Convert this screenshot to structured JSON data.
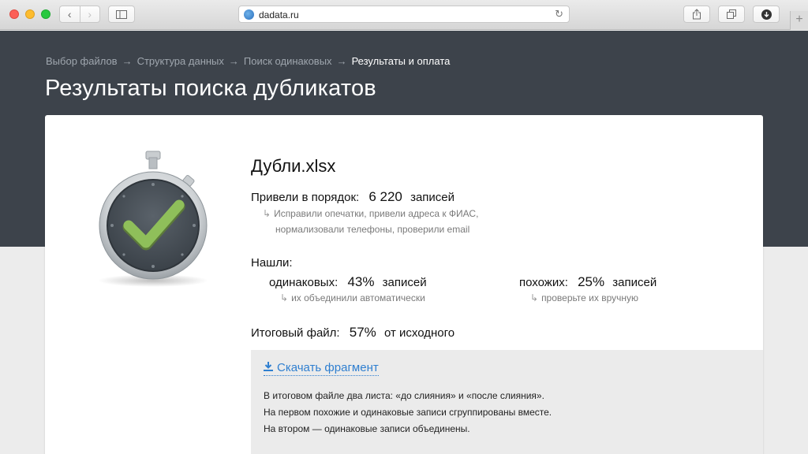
{
  "browser": {
    "url": "dadata.ru",
    "back_glyph": "‹",
    "forward_glyph": "›",
    "reload_glyph": "↻",
    "newtab_glyph": "+",
    "sidebar_icon": "sidebar-icon",
    "share_icon": "share-icon",
    "tabs_icon": "tabs-icon",
    "download_icon": "download-icon"
  },
  "breadcrumb": {
    "items": [
      "Выбор файлов",
      "Структура данных",
      "Поиск одинаковых",
      "Результаты и оплата"
    ],
    "separator": "→"
  },
  "page": {
    "title": "Результаты поиска дубликатов"
  },
  "result": {
    "file_name": "Дубли.xlsx",
    "cleaned": {
      "label": "Привели в порядок:",
      "value": "6 220",
      "unit": "записей",
      "note_line1": "Исправили опечатки, привели адреса к ФИАС,",
      "note_line2": "нормализовали телефоны, проверили email"
    },
    "found_label": "Нашли:",
    "identical": {
      "label": "одинаковых:",
      "value": "43%",
      "unit": "записей",
      "note": "их объединили автоматически"
    },
    "similar": {
      "label": "похожих:",
      "value": "25%",
      "unit": "записей",
      "note": "проверьте их вручную"
    },
    "total": {
      "label": "Итоговый файл:",
      "value": "57%",
      "unit": "от исходного"
    }
  },
  "download": {
    "link_label": "Скачать фрагмент",
    "line1": "В итоговом файле два листа: «до слияния» и «после слияния».",
    "line2": "На первом похожие и одинаковые записи сгруппированы вместе.",
    "line3": "На втором — одинаковые записи объединены."
  },
  "colors": {
    "header_bg": "#3d434b",
    "link": "#2f7fd0",
    "check": "#8fbf5a"
  }
}
